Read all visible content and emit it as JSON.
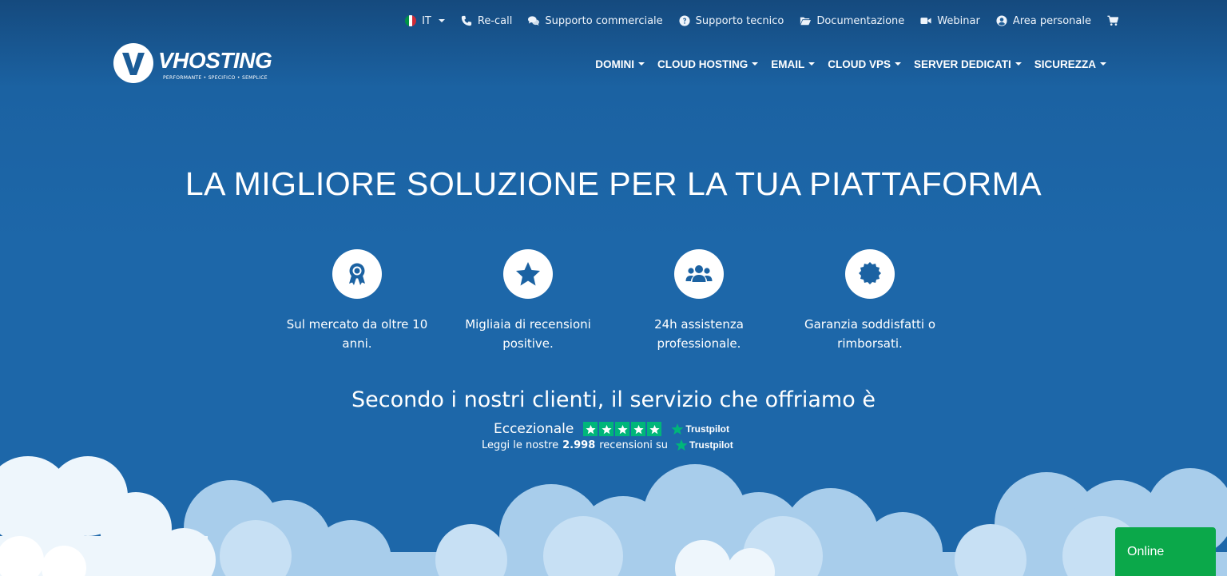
{
  "topbar": {
    "language": "IT",
    "recall": "Re-call",
    "sales_support": "Supporto commerciale",
    "tech_support": "Supporto tecnico",
    "docs": "Documentazione",
    "webinar": "Webinar",
    "account": "Area personale"
  },
  "logo": {
    "name": "VHOSTING",
    "tagline": "PERFORMANTE • SPECIFICO • SEMPLICE"
  },
  "nav": [
    {
      "label": "DOMINI"
    },
    {
      "label": "CLOUD HOSTING"
    },
    {
      "label": "EMAIL"
    },
    {
      "label": "CLOUD VPS"
    },
    {
      "label": "SERVER DEDICATI"
    },
    {
      "label": "SICUREZZA"
    }
  ],
  "hero": {
    "title": "LA MIGLIORE SOLUZIONE PER LA TUA PIATTAFORMA",
    "features": [
      {
        "icon": "award-icon",
        "text": "Sul mercato da oltre 10 anni."
      },
      {
        "icon": "star-icon",
        "text": "Migliaia di recensioni positive."
      },
      {
        "icon": "users-icon",
        "text": "24h assistenza professionale."
      },
      {
        "icon": "certificate-icon",
        "text": "Garanzia soddisfatti o rimborsati."
      }
    ],
    "subtitle": "Secondo i nostri clienti, il servizio che offriamo è"
  },
  "trustpilot": {
    "rating_label": "Eccezionale",
    "stars": 5,
    "brand": "Trustpilot",
    "reviews_prefix": "Leggi le nostre",
    "reviews_count": "2.998",
    "reviews_suffix": "recensioni su"
  },
  "chat": {
    "label": "Online"
  },
  "colors": {
    "background": "#1d67a9",
    "trustpilot_green": "#00b67a",
    "chat_green": "#0ba84a"
  }
}
